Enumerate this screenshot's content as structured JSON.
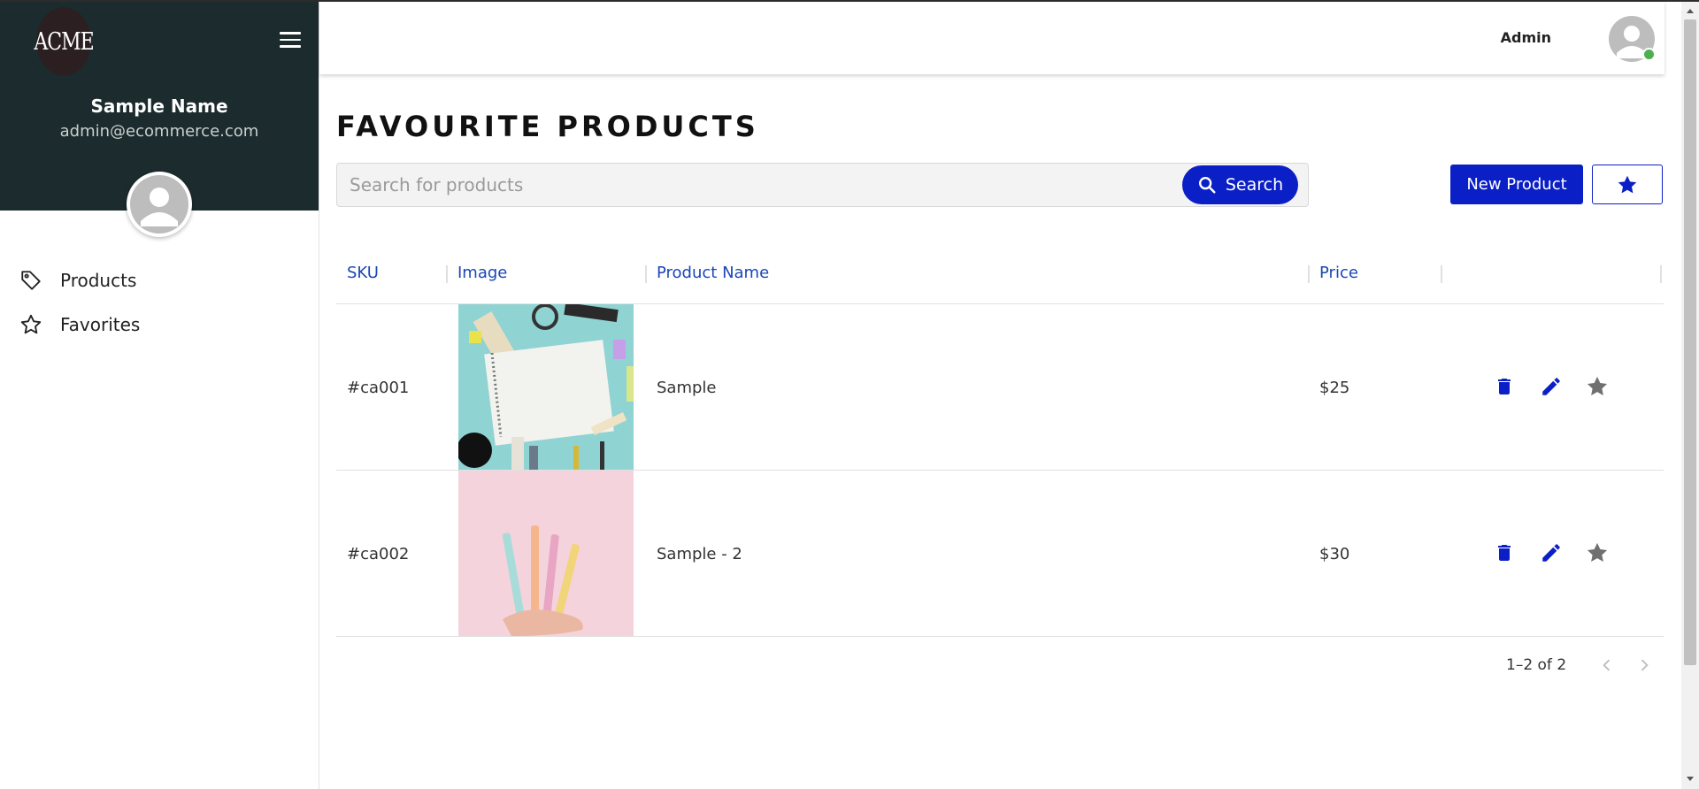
{
  "sidebar": {
    "logo_text": "ACME",
    "user_name": "Sample Name",
    "user_email": "admin@ecommerce.com",
    "items": [
      {
        "label": "Products",
        "icon": "tag-icon"
      },
      {
        "label": "Favorites",
        "icon": "star-outline-icon"
      }
    ]
  },
  "header": {
    "admin_label": "Admin",
    "status_color": "#4caf50"
  },
  "main": {
    "title": "FAVOURITE PRODUCTS",
    "search_placeholder": "Search for products",
    "search_value": "",
    "search_button": "Search",
    "new_product_button": "New Product",
    "accent_color": "#0b1fc6"
  },
  "table": {
    "headers": {
      "sku": "SKU",
      "image": "Image",
      "name": "Product Name",
      "price": "Price"
    },
    "rows": [
      {
        "sku": "#ca001",
        "name": "Sample",
        "price": "$25",
        "image": "stationery-flatlay-teal"
      },
      {
        "sku": "#ca002",
        "name": "Sample - 2",
        "price": "$30",
        "image": "highlighters-pink"
      }
    ]
  },
  "pagination": {
    "range_text": "1–2 of 2"
  }
}
